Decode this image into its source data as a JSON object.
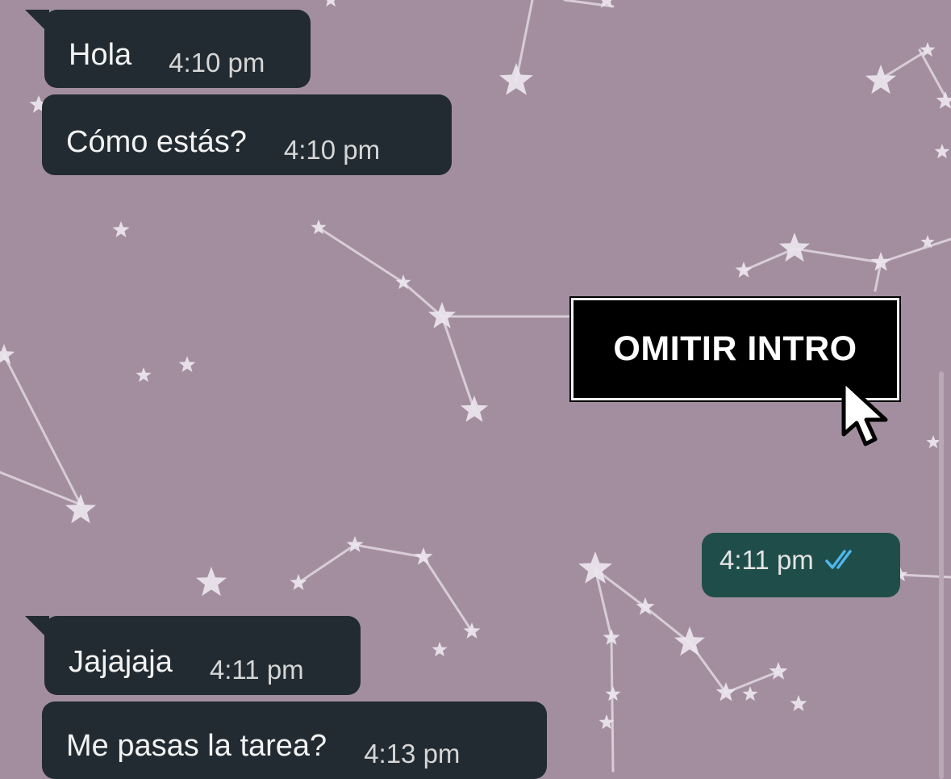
{
  "chat": {
    "messages": [
      {
        "direction": "incoming",
        "text": "Hola",
        "time": "4:10 pm"
      },
      {
        "direction": "incoming",
        "text": "Cómo estás?",
        "time": "4:10 pm"
      },
      {
        "direction": "outgoing",
        "text": "",
        "time": "4:11 pm",
        "status_icon": "double-check-read-icon"
      },
      {
        "direction": "incoming",
        "text": "Jajajaja",
        "time": "4:11 pm"
      },
      {
        "direction": "incoming",
        "text": "Me pasas la tarea?",
        "time": "4:13 pm"
      }
    ]
  },
  "overlay": {
    "skip_button_label": "OMITIR INTRO",
    "cursor_icon": "mouse-pointer-icon"
  },
  "colors": {
    "wallpaper": "#a38ea0",
    "incoming_bubble": "#222b31",
    "outgoing_bubble": "#1f4e4a",
    "read_ticks": "#4fb6ec"
  }
}
